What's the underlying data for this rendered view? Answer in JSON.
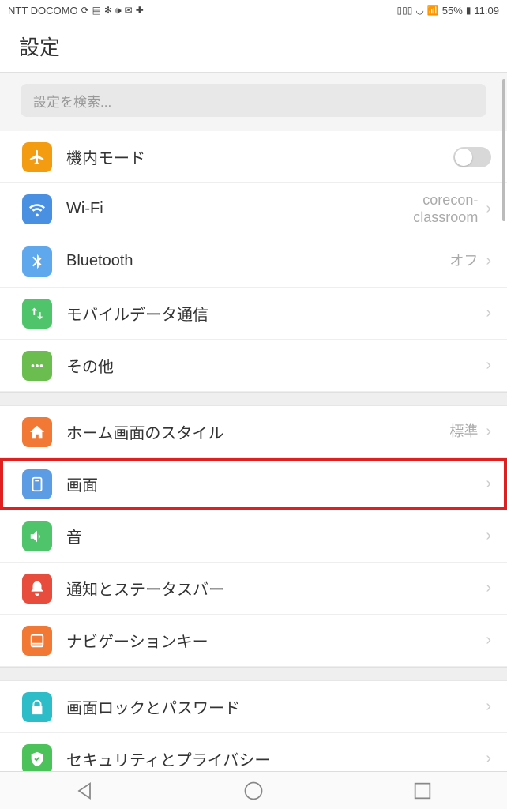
{
  "status": {
    "carrier": "NTT DOCOMO",
    "battery": "55%",
    "time": "11:09"
  },
  "header": {
    "title": "設定"
  },
  "search": {
    "placeholder": "設定を検索..."
  },
  "groups": [
    {
      "items": [
        {
          "id": "airplane",
          "icon": "airplane-icon",
          "color": "ic-orange",
          "label": "機内モード",
          "toggle": false
        },
        {
          "id": "wifi",
          "icon": "wifi-icon",
          "color": "ic-blue",
          "label": "Wi-Fi",
          "value": "corecon-\nclassroom",
          "chevron": true
        },
        {
          "id": "bluetooth",
          "icon": "bluetooth-icon",
          "color": "ic-bluel",
          "label": "Bluetooth",
          "value": "オフ",
          "chevron": true
        },
        {
          "id": "mobile-data",
          "icon": "data-icon",
          "color": "ic-green",
          "label": "モバイルデータ通信",
          "chevron": true
        },
        {
          "id": "other",
          "icon": "more-icon",
          "color": "ic-green2",
          "label": "その他",
          "chevron": true
        }
      ]
    },
    {
      "items": [
        {
          "id": "home-style",
          "icon": "home-icon",
          "color": "ic-home",
          "label": "ホーム画面のスタイル",
          "value": "標準",
          "chevron": true
        },
        {
          "id": "screen",
          "icon": "screen-icon",
          "color": "ic-blued",
          "label": "画面",
          "chevron": true,
          "highlight": true
        },
        {
          "id": "sound",
          "icon": "sound-icon",
          "color": "ic-green",
          "label": "音",
          "chevron": true
        },
        {
          "id": "notify",
          "icon": "bell-icon",
          "color": "ic-red",
          "label": "通知とステータスバー",
          "chevron": true
        },
        {
          "id": "nav-key",
          "icon": "navkey-icon",
          "color": "ic-orange2",
          "label": "ナビゲーションキー",
          "chevron": true
        }
      ]
    },
    {
      "items": [
        {
          "id": "lock",
          "icon": "lock-icon",
          "color": "ic-teal",
          "label": "画面ロックとパスワード",
          "chevron": true
        },
        {
          "id": "security",
          "icon": "shield-icon",
          "color": "ic-green3",
          "label": "セキュリティとプライバシー",
          "chevron": true
        }
      ]
    }
  ]
}
